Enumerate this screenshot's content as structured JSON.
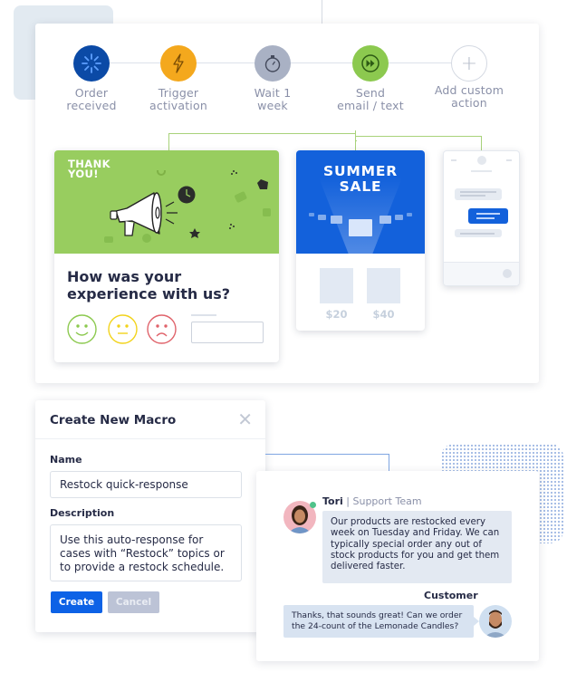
{
  "workflow": {
    "steps": [
      {
        "label_line1": "Order",
        "label_line2": "received",
        "icon": "loading-spinner-icon",
        "color": "#0b4aa6"
      },
      {
        "label_line1": "Trigger",
        "label_line2": "activation",
        "icon": "lightning-bolt-icon",
        "color": "#f4a81d"
      },
      {
        "label_line1": "Wait 1",
        "label_line2": "week",
        "icon": "stopwatch-icon",
        "color": "#a9b1c4"
      },
      {
        "label_line1": "Send",
        "label_line2": "email / text",
        "icon": "fast-forward-icon",
        "color": "#8cc94f"
      },
      {
        "label_line1": "Add custom",
        "label_line2": "action",
        "icon": "plus-icon",
        "color": "#ffffff"
      }
    ]
  },
  "thank_card": {
    "banner_line1": "THANK",
    "banner_line2": "YOU!",
    "question_line1": "How was your",
    "question_line2": "experience with us?",
    "faces": [
      "happy-face-icon",
      "neutral-face-icon",
      "sad-face-icon"
    ],
    "colors": {
      "banner": "#98cd5f",
      "happy": "#8cc94f",
      "neutral": "#f2d31b",
      "sad": "#e0636b"
    }
  },
  "sale_card": {
    "title_line1": "SUMMER",
    "title_line2": "SALE",
    "prices": [
      "$20",
      "$40"
    ],
    "color": "#1361db"
  },
  "macro": {
    "title": "Create New Macro",
    "name_label": "Name",
    "name_value": "Restock quick-response",
    "description_label": "Description",
    "description_value": "Use this auto-response for cases with “Restock” topics or to provide a restock schedule.",
    "create_label": "Create",
    "cancel_label": "Cancel",
    "accent": "#0d62e6"
  },
  "chat": {
    "agent_name": "Tori",
    "agent_team": "| Support Team",
    "agent_message": "Our products are restocked every week on Tuesday and Friday. We can typically special order any out of stock products for you and get them delivered faster.",
    "customer_label": "Customer",
    "customer_message": "Thanks, that sounds great! Can we order the 24-count of the Lemonade Candles?"
  }
}
